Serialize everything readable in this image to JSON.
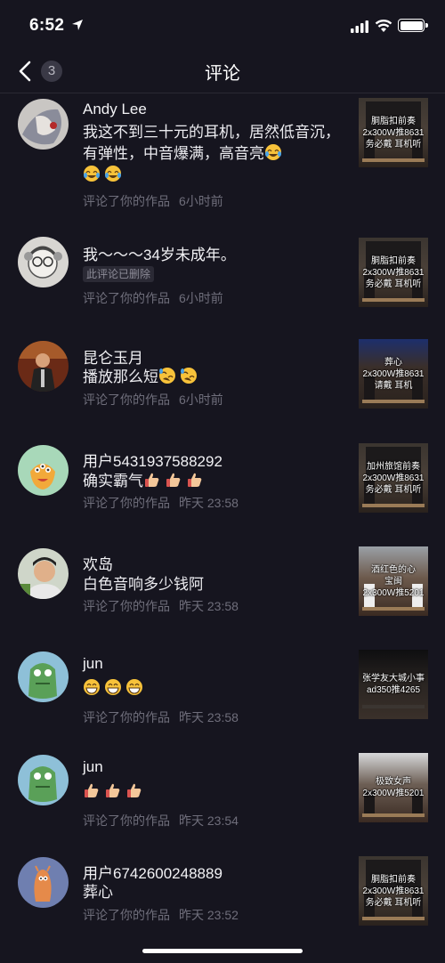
{
  "status_bar": {
    "time": "6:52"
  },
  "nav": {
    "badge": "3",
    "title": "评论"
  },
  "items": [
    {
      "user": "Andy Lee",
      "text": "我这不到三十元的耳机，居然低音沉，有弹性，中音爆满，高音亮",
      "action": "评论了你的作品",
      "time": "6小时前",
      "thumb": [
        "胴脂扣前奏",
        "2x300W推8631",
        "务必戴  耳机听"
      ]
    },
    {
      "user": "我～～～34岁未成年。",
      "deleted_tag": "此评论已删除",
      "action": "评论了你的作品",
      "time": "6小时前",
      "thumb": [
        "胴脂扣前奏",
        "2x300W推8631",
        "务必戴  耳机听"
      ]
    },
    {
      "user": "昆仑玉月",
      "text": "播放那么短",
      "action": "评论了你的作品",
      "time": "6小时前",
      "thumb": [
        "葬心",
        "2x300W推8631",
        "请戴  耳机"
      ]
    },
    {
      "user": "用户5431937588292",
      "text": "确实霸气",
      "action": "评论了你的作品",
      "time": "昨天 23:58",
      "thumb": [
        "加州旅馆前奏",
        "2x300W推8631",
        "务必戴  耳机听"
      ]
    },
    {
      "user": "欢岛",
      "text": "白色音响多少钱阿",
      "action": "评论了你的作品",
      "time": "昨天 23:58",
      "thumb": [
        "酒红色的心",
        "宝闽",
        "2x300W推5201"
      ]
    },
    {
      "user": "jun",
      "text": "",
      "action": "评论了你的作品",
      "time": "昨天 23:58",
      "thumb": [
        "张学友大城小事",
        "ad350推4265"
      ]
    },
    {
      "user": "jun",
      "text": "",
      "action": "评论了你的作品",
      "time": "昨天 23:54",
      "thumb": [
        "极致女声",
        "2x300W推5201"
      ]
    },
    {
      "user": "用户6742600248889",
      "text": "葬心",
      "action": "评论了你的作品",
      "time": "昨天 23:52",
      "thumb": [
        "胴脂扣前奏",
        "2x300W推8631",
        "务必戴  耳机听"
      ]
    }
  ],
  "colors": {
    "background": "#16151f",
    "secondary_text": "#6f6e7b"
  },
  "icons": {
    "back": "chevron-left-icon",
    "emoji_laugh": "tears-of-joy-emoji",
    "emoji_rofl": "rolling-laugh-emoji",
    "emoji_thumb": "thumbs-up-emoji",
    "emoji_grin": "grinning-emoji"
  }
}
